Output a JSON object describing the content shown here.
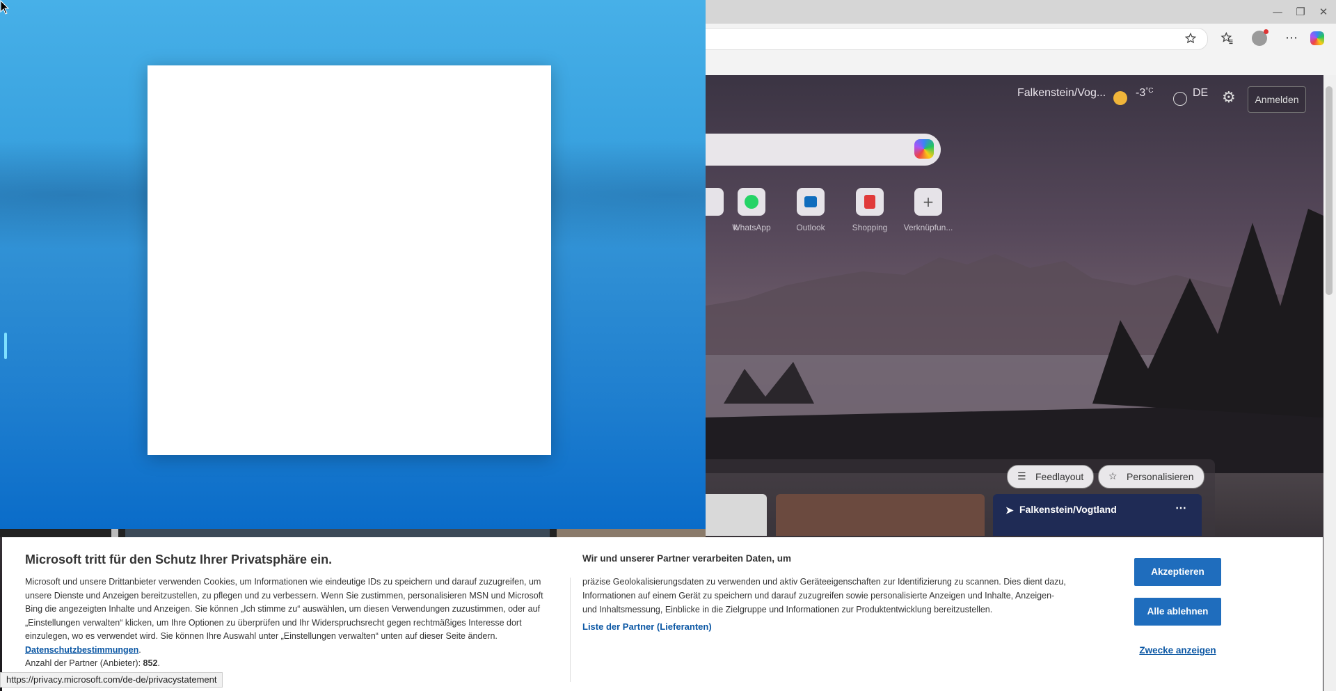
{
  "browser": {
    "minimize": "—",
    "restore": "❐",
    "close": "✕",
    "icons": [
      "star-outline-icon",
      "favorites-icon",
      "profile-icon",
      "more-icon",
      "copilot-icon"
    ]
  },
  "ntp": {
    "location": "Falkenstein/Vog...",
    "temperature": "-3",
    "temp_unit": "°C",
    "language": "DE",
    "signin": "Anmelden",
    "tiles": [
      {
        "label": "k",
        "icon": "partial-tile-icon"
      },
      {
        "label": "WhatsApp",
        "icon": "whatsapp-icon"
      },
      {
        "label": "Outlook",
        "icon": "outlook-icon"
      },
      {
        "label": "Shopping",
        "icon": "shopping-bag-icon"
      },
      {
        "label": "Verknüpfun...",
        "icon": "add-icon"
      }
    ],
    "feed_layout": "Feedlayout",
    "personalize": "Personalisieren",
    "weather_location": "Falkenstein/Vogtland"
  },
  "consent": {
    "title": "Microsoft tritt für den Schutz Ihrer Privatsphäre ein.",
    "text": "Microsoft und unsere Drittanbieter verwenden Cookies, um Informationen wie eindeutige IDs zu speichern und darauf zuzugreifen, um unsere Dienste und Anzeigen bereitzustellen, zu pflegen und zu verbessern. Wenn Sie zustimmen, personalisieren MSN und Microsoft Bing die angezeigten Inhalte und Anzeigen. Sie können „Ich stimme zu“ auswählen, um diesen Verwendungen zuzustimmen, oder auf „Einstellungen verwalten“ klicken, um Ihre Optionen zu überprüfen und Ihr Widerspruchsrecht gegen rechtmäßiges Interesse dort einzulegen, wo es verwendet wird.  Sie können Ihre Auswahl unter „Einstellungen verwalten“ unten auf dieser Seite ändern.",
    "privacy_link": "Datenschutzbestimmungen",
    "partners_label": "Anzahl der Partner (Anbieter):",
    "partners_count": "852",
    "title2": "Wir und unserer Partner verarbeiten Daten, um",
    "text2": "präzise Geolokalisierungsdaten zu verwenden und aktiv Geräteeigenschaften zur Identifizierung zu scannen. Dies dient dazu, Informationen auf einem Gerät zu speichern und darauf zuzugreifen sowie personalisierte Anzeigen und Inhalte, Anzeigen- und Inhaltsmessung, Einblicke in die Zielgruppe und Informationen zur Produktentwicklung bereitzustellen.",
    "partners_link": "Liste der Partner (Lieferanten)",
    "accept": "Akzeptieren",
    "reject": "Alle ablehnen",
    "purposes": "Zwecke anzeigen"
  },
  "status_url": "https://privacy.microsoft.com/de-de/privacystatement"
}
